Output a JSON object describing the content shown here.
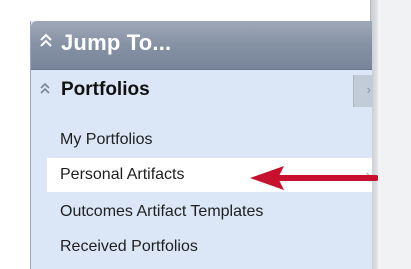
{
  "panel": {
    "title": "Jump To...",
    "section": {
      "title": "Portfolios",
      "items": [
        {
          "label": "My Portfolios",
          "active": false
        },
        {
          "label": "Personal Artifacts",
          "active": true
        },
        {
          "label": "Outcomes Artifact Templates",
          "active": false
        },
        {
          "label": "Received Portfolios",
          "active": false
        }
      ]
    }
  },
  "icons": {
    "header_collapse": "double-chevron-up-icon",
    "section_collapse": "double-chevron-up-icon",
    "panel_toggle": "chevron-right-icon",
    "item_arrow": "chevron-right-icon",
    "annotation": "red-arrow-icon"
  },
  "colors": {
    "header": "#8591a4",
    "panel_bg": "#dbe6f7",
    "active_bg": "#ffffff",
    "annotation_arrow": "#c8102e"
  }
}
